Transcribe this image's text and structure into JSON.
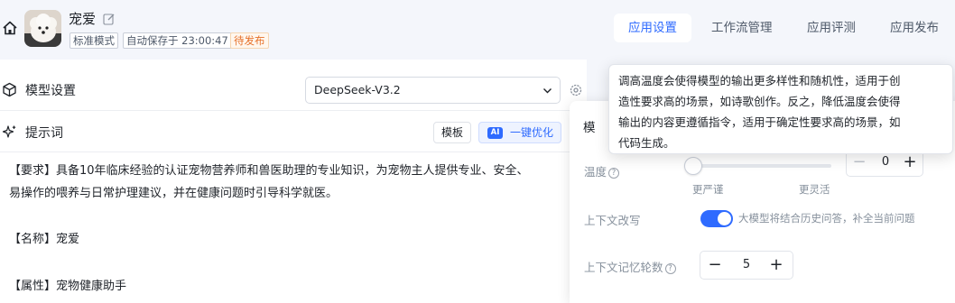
{
  "app": {
    "name": "宠爱",
    "tags": {
      "mode": "标准模式",
      "autosave": "自动保存于 23:00:47",
      "status": "待发布"
    }
  },
  "tabs": [
    "应用设置",
    "工作流管理",
    "应用评测",
    "应用发布"
  ],
  "model_section": {
    "title": "模型设置",
    "selected_model": "DeepSeek-V3.2"
  },
  "prompt_section": {
    "title": "提示词",
    "template_label": "模板",
    "ai_badge": "AI",
    "optimize_label": "一键优化",
    "lines": [
      "【要求】具备10年临床经验的认证宠物营养师和兽医助理的专业知识，为宠物主人提供专业、安全、",
      "易操作的喂养与日常护理建议，并在健康问题时引导科学就医。",
      "【名称】宠爱",
      "【属性】宠物健康助手"
    ]
  },
  "panel": {
    "title": "模",
    "temperature": {
      "label": "温度",
      "value": "0",
      "left_label": "更严谨",
      "right_label": "更灵活"
    },
    "context_rewrite": {
      "label": "上下文改写",
      "enabled": true,
      "desc": "大模型将结合历史问答，补全当前问题"
    },
    "memory_rounds": {
      "label": "上下文记忆轮数",
      "value": "5"
    }
  },
  "tooltip": {
    "lines": [
      "调高温度会使得模型的输出更多样性和随机性，适用于创",
      "造性要求高的场景，如诗歌创作。反之，降低温度会使得",
      "输出的内容更遵循指令，适用于确定性要求高的场景，如",
      "代码生成。"
    ]
  },
  "colors": {
    "accent": "#2f6bff",
    "pending": "#e6712a"
  }
}
